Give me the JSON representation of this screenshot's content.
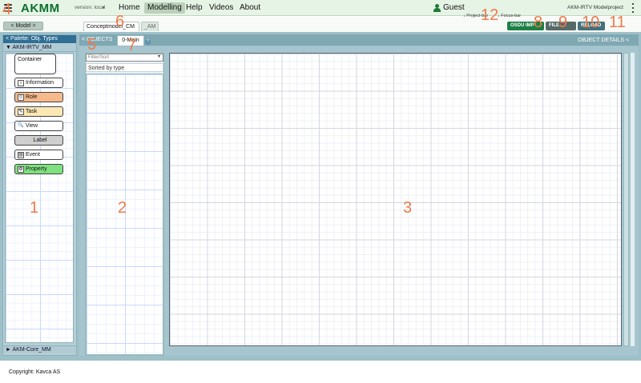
{
  "app": {
    "brand": "AKMM",
    "version": "version: local",
    "user": "Guest",
    "project_name": "AKM-IRTV Modelproject"
  },
  "nav": {
    "items": [
      "Home",
      "Modelling",
      "Help",
      "Videos",
      "About"
    ],
    "active": "Modelling"
  },
  "toolbar": {
    "model_button": "< Model >",
    "tabs": [
      "Conceptmodel_CM",
      "_AM"
    ],
    "project_bar_label": "↓ Project-bar",
    "focus_bar_label": "↓ Focus-bar",
    "osdu_button": "OSDU IMP",
    "file_button": "FILE",
    "reload_button": "RELOAD"
  },
  "palette": {
    "header": "< Palette: Obj. Types",
    "metamodel": "▼ AKM-IRTV_MM",
    "core_metamodel": "► AKM-Core_MM",
    "types": {
      "container": "Container",
      "information": "Information",
      "role": "Role",
      "task": "Task",
      "view": "View",
      "label": "Label",
      "event": "Event",
      "property": "Property"
    }
  },
  "workspace": {
    "objects_tab": "< OBJECTS",
    "main_tab": "0-Main",
    "help": "?",
    "object_details": "OBJECT DETAILS <",
    "filter_placeholder": "Filter/Sort",
    "sorted_label": "Sorted by type"
  },
  "footer": {
    "copyright": "Copyright: Kavca AS"
  },
  "annotations": [
    "1",
    "2",
    "3",
    "4",
    "5",
    "6",
    "7",
    "8",
    "9",
    "10",
    "11",
    "12"
  ],
  "colors": {
    "brand": "#0b6e2e",
    "annotation": "#f07a4a",
    "palette_header": "#2f6e95",
    "osdu": "#1c7f45",
    "file": "#566a68",
    "reload": "#43707c",
    "role_fill": "#f6b98b",
    "task_fill": "#fde8b5",
    "label_fill": "#cfcfcf",
    "property_fill": "#7ee07e"
  }
}
